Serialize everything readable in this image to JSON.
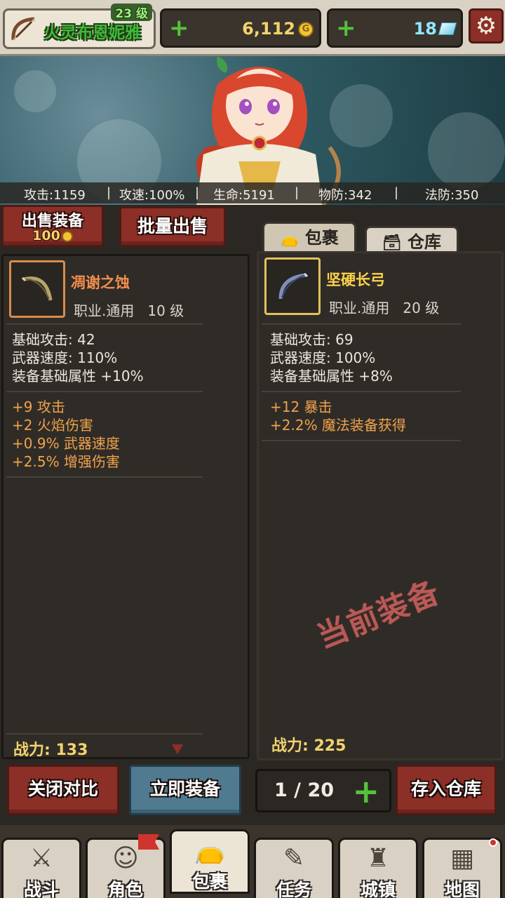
{
  "player": {
    "name": "火灵布恩妮雅",
    "level": "23 级",
    "class_icon": "bow-icon"
  },
  "currency": {
    "gold": "6,112",
    "gems": "18"
  },
  "stats": {
    "attack": "攻击:1159",
    "attack_speed": "攻速:100%",
    "hp": "生命:5191",
    "phys_def": "物防:342",
    "magic_def": "法防:350"
  },
  "actions": {
    "sell_label": "出售装备",
    "sell_price": "100",
    "batch_sell_label": "批量出售"
  },
  "tabs": {
    "bag": "包裹",
    "storage": "仓库"
  },
  "left_item": {
    "name": "凋谢之蚀",
    "meta": "职业.通用   10 级",
    "base": [
      "基础攻击:  42",
      "武器速度:  110%",
      "装备基础属性 +10%"
    ],
    "affixes": [
      "+9 攻击",
      "+2 火焰伤害",
      "+0.9% 武器速度",
      "+2.5% 增强伤害"
    ],
    "power_label": "战力:",
    "power": "133"
  },
  "right_item": {
    "name": "坚硬长弓",
    "meta": "职业.通用   20 级",
    "base": [
      "基础攻击:  69",
      "武器速度:  100%",
      "装备基础属性 +8%"
    ],
    "affixes": [
      "+12 暴击",
      "+2.2% 魔法装备获得"
    ],
    "power_label": "战力:",
    "power": "225",
    "stamp": "当前装备"
  },
  "bottom_actions": {
    "close_compare": "关闭对比",
    "equip_now": "立即装备",
    "capacity": "1 / 20",
    "store": "存入仓库"
  },
  "nav": [
    {
      "label": "战斗",
      "icon": "crossed-swords-icon"
    },
    {
      "label": "角色",
      "icon": "character-face-icon"
    },
    {
      "label": "包裹",
      "icon": "bag-icon"
    },
    {
      "label": "任务",
      "icon": "quest-icon"
    },
    {
      "label": "城镇",
      "icon": "castle-icon"
    },
    {
      "label": "地图",
      "icon": "map-icon"
    }
  ],
  "colors": {
    "accent_red": "#8c2f27",
    "accent_blue": "#4f7a90",
    "rare_orange": "#f28e4c",
    "rare_yellow": "#ffd24a",
    "affix": "#f2a24a",
    "power": "#f3d36b",
    "green_plus": "#56c23b"
  }
}
